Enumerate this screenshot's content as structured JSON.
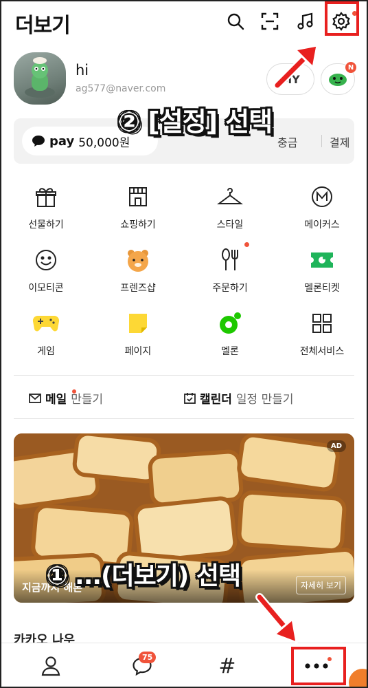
{
  "header": {
    "title": "더보기",
    "icons": [
      "search-icon",
      "scan-icon",
      "music-icon",
      "settings-icon"
    ]
  },
  "profile": {
    "name": "hi",
    "email": "ag577@naver.com",
    "my_label": "MY",
    "notification_badge": "N"
  },
  "pay": {
    "logo": "pay",
    "amount": "50,000원",
    "charge_label": "충금",
    "pay_label": "결제"
  },
  "services": [
    {
      "label": "선물하기",
      "icon": "gift-icon"
    },
    {
      "label": "쇼핑하기",
      "icon": "shop-icon"
    },
    {
      "label": "스타일",
      "icon": "hanger-icon"
    },
    {
      "label": "메이커스",
      "icon": "makers-icon"
    },
    {
      "label": "이모티콘",
      "icon": "emoticon-icon"
    },
    {
      "label": "프렌즈샵",
      "icon": "friends-icon"
    },
    {
      "label": "주문하기",
      "icon": "order-icon"
    },
    {
      "label": "멜론티켓",
      "icon": "ticket-icon"
    },
    {
      "label": "게임",
      "icon": "game-icon"
    },
    {
      "label": "페이지",
      "icon": "page-icon"
    },
    {
      "label": "멜론",
      "icon": "melon-icon"
    },
    {
      "label": "전체서비스",
      "icon": "all-services-icon"
    }
  ],
  "quick": {
    "mail_title": "메일",
    "mail_sub": "만들기",
    "calendar_title": "캘린더",
    "calendar_sub": "일정 만들기"
  },
  "ad": {
    "badge": "AD",
    "caption": "지금까지 해본",
    "more": "자세히 보기"
  },
  "kakao_now": "카카오 나우",
  "nav": {
    "chat_badge": "75",
    "hash": "#"
  },
  "annotations": {
    "step2": "② [설정] 선택",
    "step1": "① ...(더보기) 선택"
  },
  "colors": {
    "accent_red": "#e8201f",
    "badge_red": "#f0533a",
    "kakao_yellow": "#fee500",
    "melon_green": "#1ec800"
  }
}
